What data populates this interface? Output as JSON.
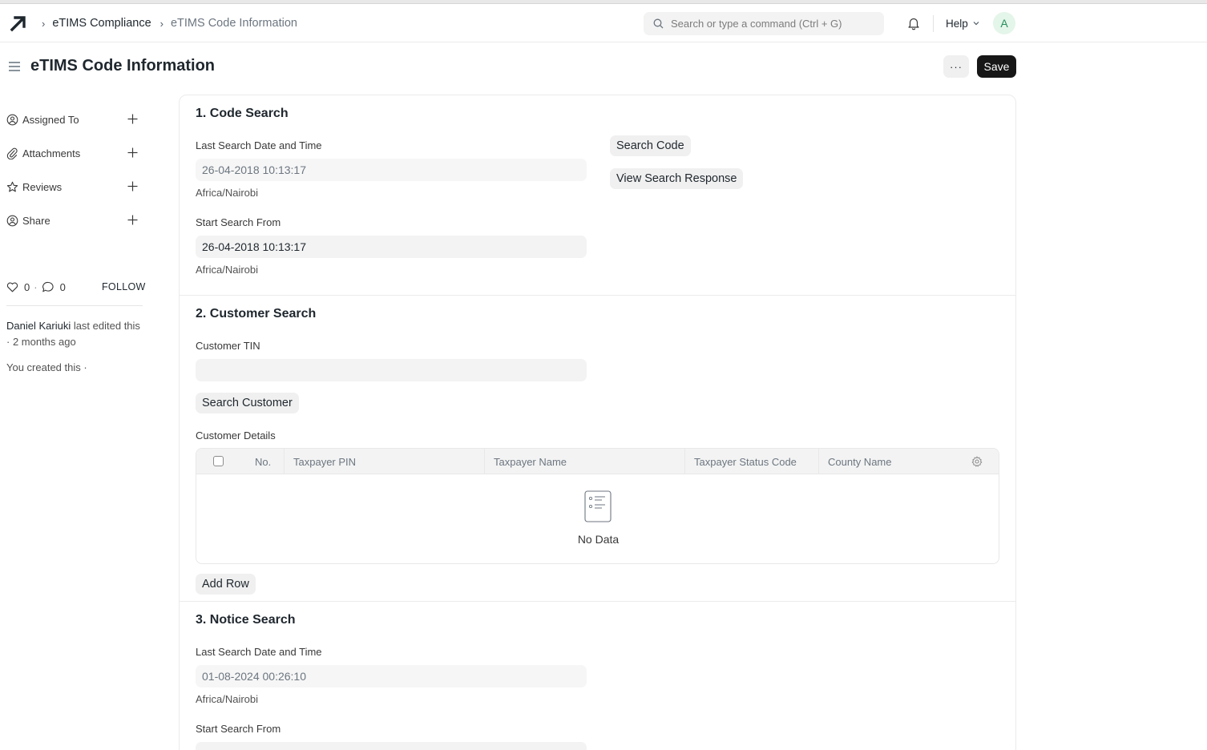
{
  "navbar": {
    "breadcrumbs": [
      "eTIMS Compliance",
      "eTIMS Code Information"
    ],
    "search_placeholder": "Search or type a command (Ctrl + G)",
    "help_label": "Help",
    "avatar_initial": "A"
  },
  "page": {
    "title": "eTIMS Code Information",
    "more_label": "···",
    "save_label": "Save"
  },
  "sidebar": {
    "items": [
      {
        "label": "Assigned To",
        "icon": "assign-icon"
      },
      {
        "label": "Attachments",
        "icon": "paperclip-icon"
      },
      {
        "label": "Reviews",
        "icon": "star-icon"
      },
      {
        "label": "Share",
        "icon": "share-icon"
      }
    ],
    "likes": "0",
    "comments": "0",
    "dot": "·",
    "follow_label": "FOLLOW",
    "activity_user": "Daniel Kariuki",
    "activity_text": " last edited this · 2 months ago",
    "created_text": "You created this ·"
  },
  "sections": {
    "code_search": {
      "title": "1. Code Search",
      "last_search_label": "Last Search Date and Time",
      "last_search_value": "26-04-2018 10:13:17",
      "timezone": "Africa/Nairobi",
      "start_from_label": "Start Search From",
      "start_from_value": "26-04-2018 10:13:17",
      "start_timezone": "Africa/Nairobi",
      "search_code_button": "Search Code",
      "view_response_button": "View Search Response"
    },
    "customer_search": {
      "title": "2. Customer Search",
      "tin_label": "Customer TIN",
      "tin_value": "",
      "search_button": "Search Customer",
      "details_label": "Customer Details",
      "columns": [
        "No.",
        "Taxpayer PIN",
        "Taxpayer Name",
        "Taxpayer Status Code",
        "County Name"
      ],
      "empty_text": "No Data",
      "add_row_button": "Add Row"
    },
    "notice_search": {
      "title": "3. Notice Search",
      "last_search_label": "Last Search Date and Time",
      "last_search_value": "01-08-2024 00:26:10",
      "timezone": "Africa/Nairobi",
      "start_from_label": "Start Search From"
    }
  }
}
